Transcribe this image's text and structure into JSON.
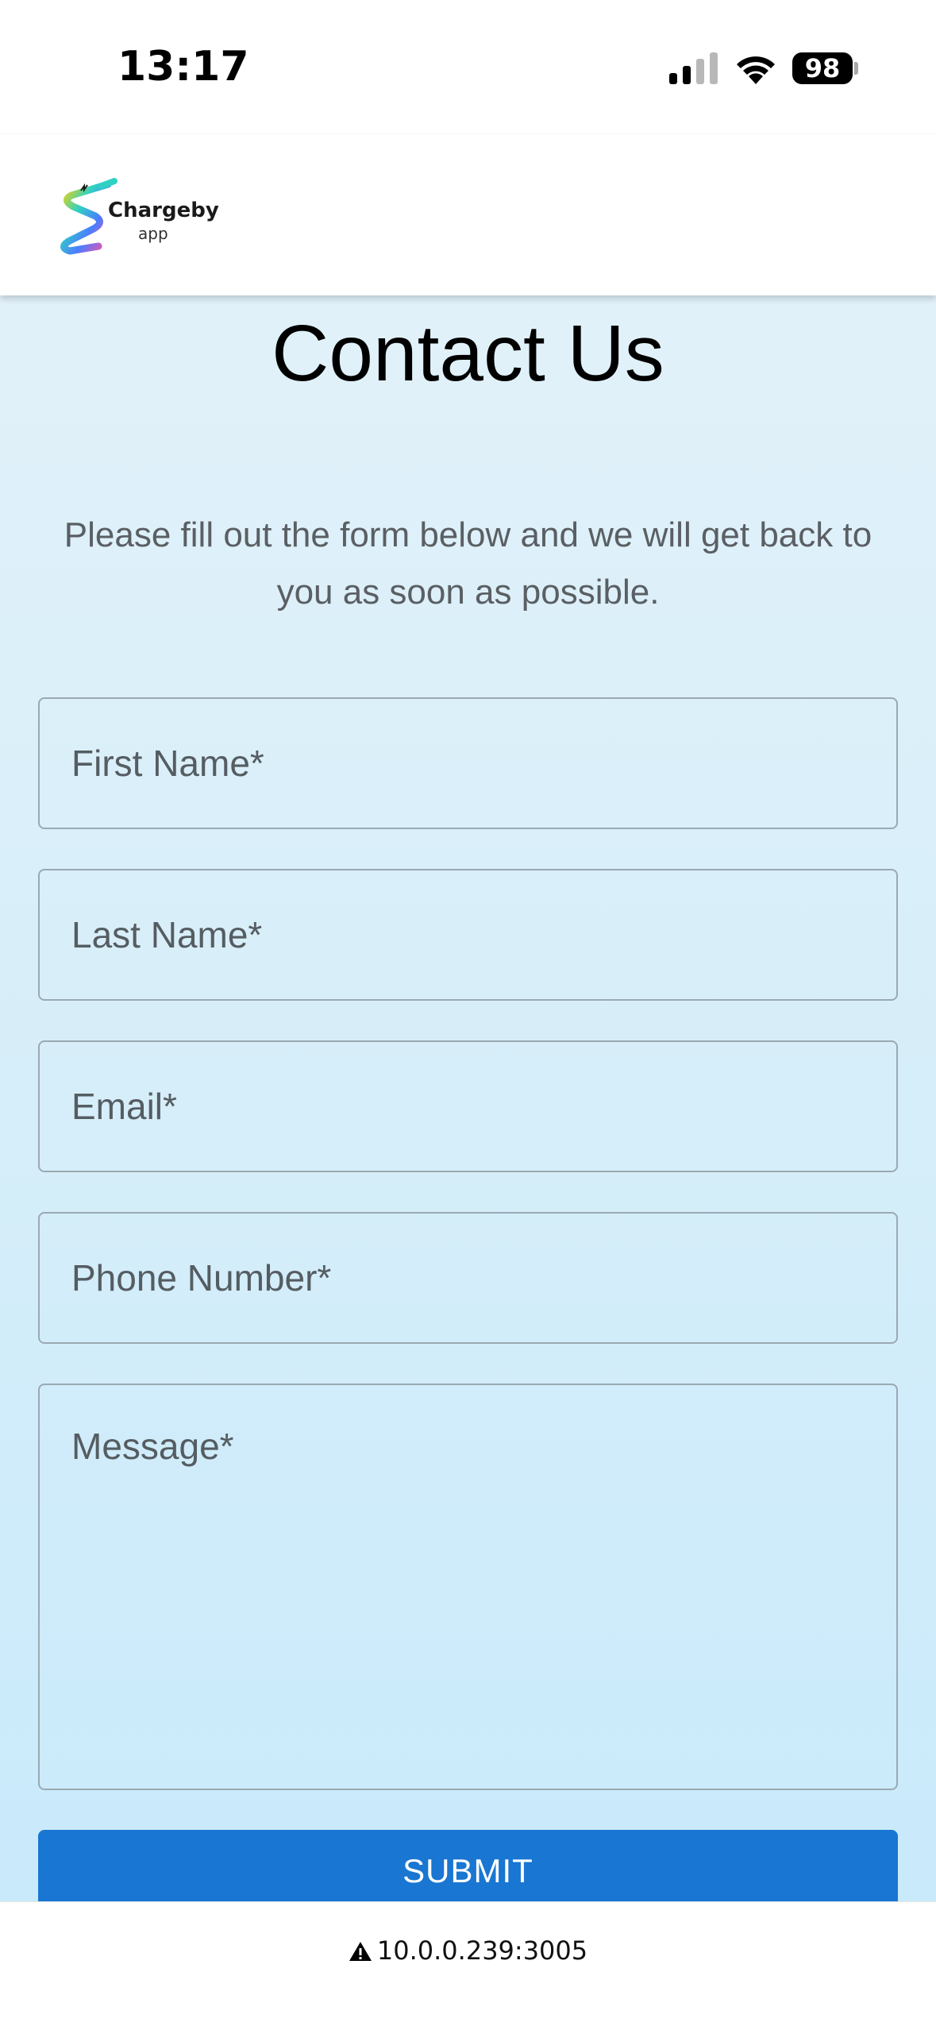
{
  "status_bar": {
    "time": "13:17",
    "battery_level": "98",
    "signal_icon": "cellular-signal-icon",
    "wifi_icon": "wifi-icon"
  },
  "header": {
    "logo_name": "Chargeby",
    "logo_sub": "app"
  },
  "page": {
    "title": "Contact Us",
    "subtitle": "Please fill out the form below and we will get back to you as soon as possible."
  },
  "form": {
    "first_name_placeholder": "First Name*",
    "last_name_placeholder": "Last Name*",
    "email_placeholder": "Email*",
    "phone_placeholder": "Phone Number*",
    "message_placeholder": "Message*",
    "submit_label": "SUBMIT"
  },
  "browser": {
    "url": "10.0.0.239:3005",
    "warning_icon": "warning-triangle-icon"
  },
  "colors": {
    "accent": "#1976d2",
    "background_top": "#e1f1f9",
    "background_bottom": "#c9eafb"
  }
}
